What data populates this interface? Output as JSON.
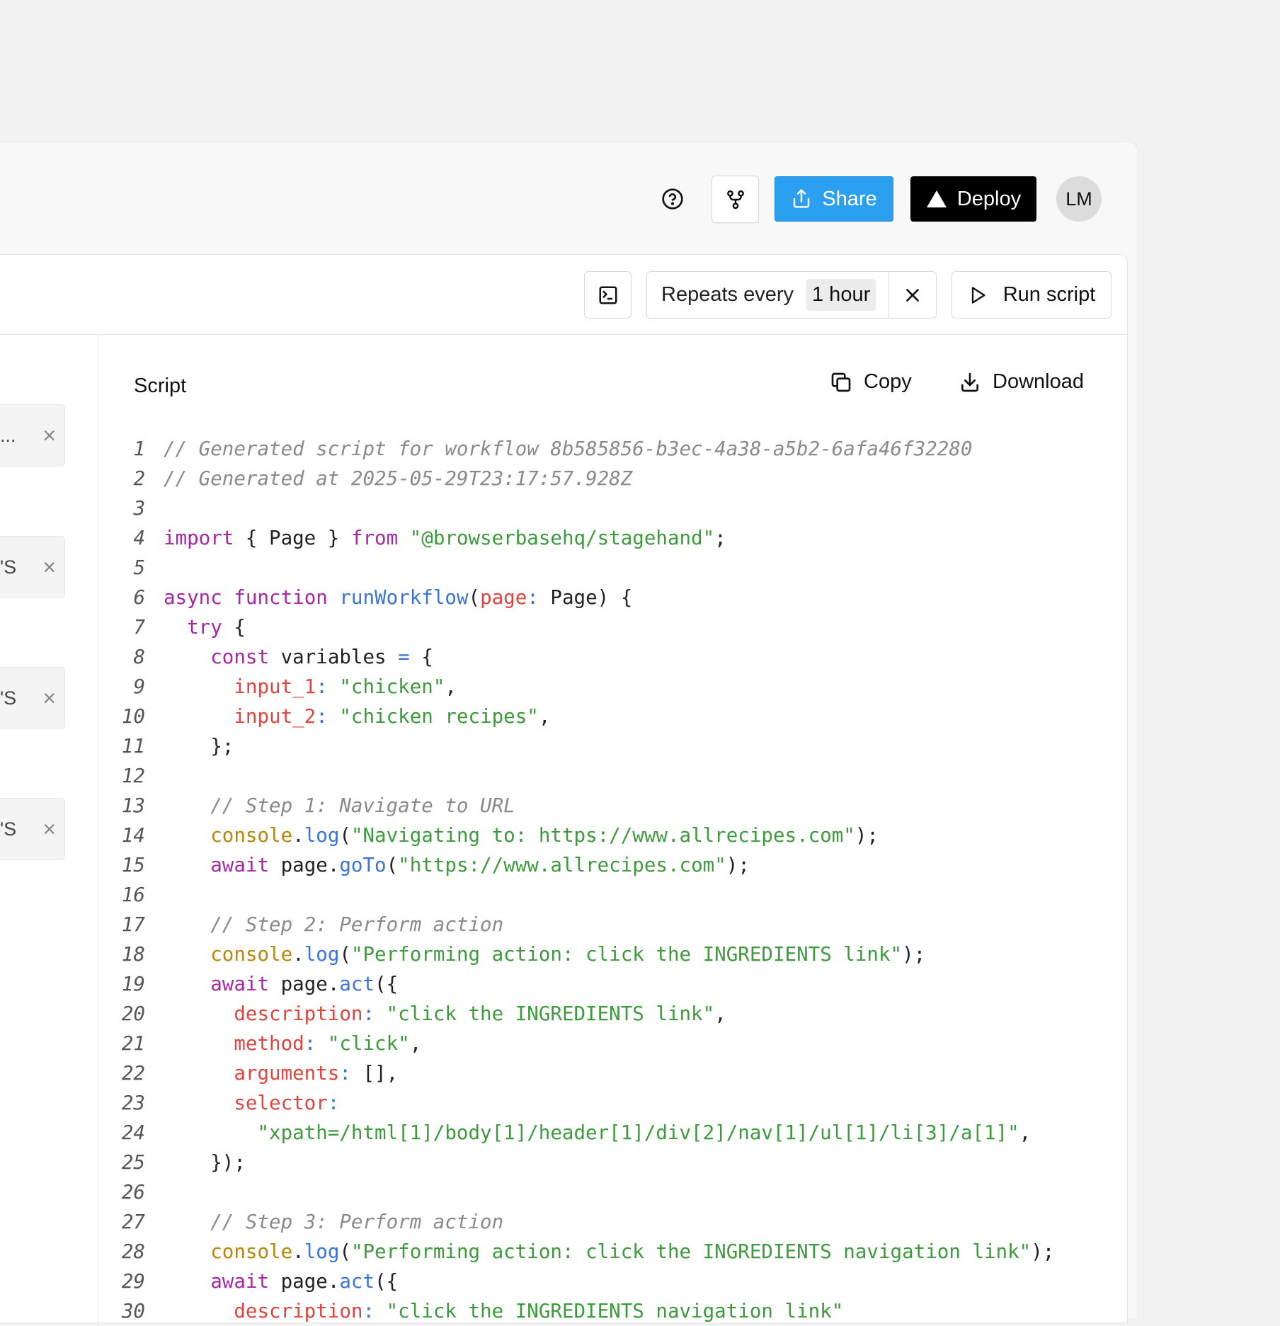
{
  "header": {
    "share_label": "Share",
    "deploy_label": "Deploy",
    "avatar_initials": "LM"
  },
  "toolbar": {
    "repeat_label": "Repeats every",
    "repeat_value": "1 hour",
    "run_label": "Run script"
  },
  "variables": [
    {
      "text": "..."
    },
    {
      "text": "'S"
    },
    {
      "text": "'S"
    },
    {
      "text": "'S"
    }
  ],
  "script": {
    "title": "Script",
    "copy_label": "Copy",
    "download_label": "Download",
    "lines": [
      [
        [
          "c",
          "// Generated script for workflow 8b585856-b3ec-4a38-a5b2-6afa46f32280"
        ]
      ],
      [
        [
          "c",
          "// Generated at 2025-05-29T23:17:57.928Z"
        ]
      ],
      [],
      [
        [
          "k",
          "import"
        ],
        [
          "p",
          " { Page } "
        ],
        [
          "k",
          "from"
        ],
        [
          "p",
          " "
        ],
        [
          "s",
          "\"@browserbasehq/stagehand\""
        ],
        [
          "p",
          ";"
        ]
      ],
      [],
      [
        [
          "k",
          "async"
        ],
        [
          "p",
          " "
        ],
        [
          "k",
          "function"
        ],
        [
          "p",
          " "
        ],
        [
          "f",
          "runWorkflow"
        ],
        [
          "p",
          "("
        ],
        [
          "r",
          "page"
        ],
        [
          "o",
          ":"
        ],
        [
          "p",
          " Page) {"
        ]
      ],
      [
        [
          "p",
          "  "
        ],
        [
          "k",
          "try"
        ],
        [
          "p",
          " {"
        ]
      ],
      [
        [
          "p",
          "    "
        ],
        [
          "k",
          "const"
        ],
        [
          "p",
          " variables "
        ],
        [
          "o",
          "="
        ],
        [
          "p",
          " {"
        ]
      ],
      [
        [
          "p",
          "      "
        ],
        [
          "r",
          "input_1"
        ],
        [
          "o",
          ":"
        ],
        [
          "p",
          " "
        ],
        [
          "s",
          "\"chicken\""
        ],
        [
          "p",
          ","
        ]
      ],
      [
        [
          "p",
          "      "
        ],
        [
          "r",
          "input_2"
        ],
        [
          "o",
          ":"
        ],
        [
          "p",
          " "
        ],
        [
          "s",
          "\"chicken recipes\""
        ],
        [
          "p",
          ","
        ]
      ],
      [
        [
          "p",
          "    };"
        ]
      ],
      [],
      [
        [
          "p",
          "    "
        ],
        [
          "c",
          "// Step 1: Navigate to URL"
        ]
      ],
      [
        [
          "p",
          "    "
        ],
        [
          "b",
          "console"
        ],
        [
          "p",
          "."
        ],
        [
          "f",
          "log"
        ],
        [
          "p",
          "("
        ],
        [
          "s",
          "\"Navigating to: https://www.allrecipes.com\""
        ],
        [
          "p",
          ");"
        ]
      ],
      [
        [
          "p",
          "    "
        ],
        [
          "k",
          "await"
        ],
        [
          "p",
          " page."
        ],
        [
          "f",
          "goTo"
        ],
        [
          "p",
          "("
        ],
        [
          "s",
          "\"https://www.allrecipes.com\""
        ],
        [
          "p",
          ");"
        ]
      ],
      [],
      [
        [
          "p",
          "    "
        ],
        [
          "c",
          "// Step 2: Perform action"
        ]
      ],
      [
        [
          "p",
          "    "
        ],
        [
          "b",
          "console"
        ],
        [
          "p",
          "."
        ],
        [
          "f",
          "log"
        ],
        [
          "p",
          "("
        ],
        [
          "s",
          "\"Performing action: click the INGREDIENTS link\""
        ],
        [
          "p",
          ");"
        ]
      ],
      [
        [
          "p",
          "    "
        ],
        [
          "k",
          "await"
        ],
        [
          "p",
          " page."
        ],
        [
          "f",
          "act"
        ],
        [
          "p",
          "({"
        ]
      ],
      [
        [
          "p",
          "      "
        ],
        [
          "r",
          "description"
        ],
        [
          "o",
          ":"
        ],
        [
          "p",
          " "
        ],
        [
          "s",
          "\"click the INGREDIENTS link\""
        ],
        [
          "p",
          ","
        ]
      ],
      [
        [
          "p",
          "      "
        ],
        [
          "r",
          "method"
        ],
        [
          "o",
          ":"
        ],
        [
          "p",
          " "
        ],
        [
          "s",
          "\"click\""
        ],
        [
          "p",
          ","
        ]
      ],
      [
        [
          "p",
          "      "
        ],
        [
          "r",
          "arguments"
        ],
        [
          "o",
          ":"
        ],
        [
          "p",
          " [],"
        ]
      ],
      [
        [
          "p",
          "      "
        ],
        [
          "r",
          "selector"
        ],
        [
          "o",
          ":"
        ]
      ],
      [
        [
          "p",
          "        "
        ],
        [
          "s",
          "\"xpath=/html[1]/body[1]/header[1]/div[2]/nav[1]/ul[1]/li[3]/a[1]\""
        ],
        [
          "p",
          ","
        ]
      ],
      [
        [
          "p",
          "    });"
        ]
      ],
      [],
      [
        [
          "p",
          "    "
        ],
        [
          "c",
          "// Step 3: Perform action"
        ]
      ],
      [
        [
          "p",
          "    "
        ],
        [
          "b",
          "console"
        ],
        [
          "p",
          "."
        ],
        [
          "f",
          "log"
        ],
        [
          "p",
          "("
        ],
        [
          "s",
          "\"Performing action: click the INGREDIENTS navigation link\""
        ],
        [
          "p",
          ");"
        ]
      ],
      [
        [
          "p",
          "    "
        ],
        [
          "k",
          "await"
        ],
        [
          "p",
          " page."
        ],
        [
          "f",
          "act"
        ],
        [
          "p",
          "({"
        ]
      ],
      [
        [
          "p",
          "      "
        ],
        [
          "r",
          "description"
        ],
        [
          "o",
          ":"
        ],
        [
          "p",
          " "
        ],
        [
          "s",
          "\"click the INGREDIENTS navigation link\""
        ]
      ]
    ]
  }
}
